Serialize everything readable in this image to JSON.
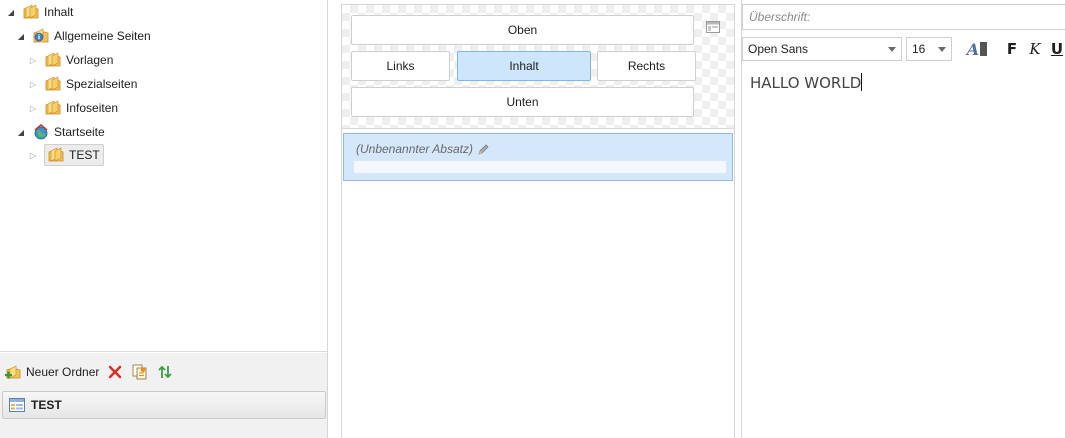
{
  "tree": {
    "items": [
      {
        "label": "Inhalt",
        "expanded": true,
        "icon": "folder-icon"
      },
      {
        "label": "Allgemeine Seiten",
        "expanded": true,
        "icon": "info-folder-icon"
      },
      {
        "label": "Vorlagen",
        "expanded": false,
        "icon": "folder-icon"
      },
      {
        "label": "Spezialseiten",
        "expanded": false,
        "icon": "folder-icon"
      },
      {
        "label": "Infoseiten",
        "expanded": false,
        "icon": "folder-icon"
      },
      {
        "label": "Startseite",
        "expanded": true,
        "icon": "home-globe-icon"
      },
      {
        "label": "TEST",
        "expanded": false,
        "icon": "folder-icon",
        "selected": true
      }
    ]
  },
  "toolbar": {
    "new_folder_label": "Neuer Ordner",
    "delete_icon": "delete-icon",
    "copy_icon": "copy-page-icon",
    "sort_icon": "sort-icon"
  },
  "page_tab": {
    "label": "TEST"
  },
  "layout": {
    "regions": {
      "top": "Oben",
      "left": "Links",
      "content": "Inhalt",
      "right": "Rechts",
      "bottom": "Unten"
    },
    "active_region": "Inhalt"
  },
  "paragraphs": [
    {
      "title": "(Unbenannter Absatz)"
    }
  ],
  "editor": {
    "heading_placeholder": "Überschrift:",
    "font_family": "Open Sans",
    "font_size": "16",
    "bold_label": "F",
    "italic_label": "K",
    "underline_label": "U",
    "color_label": "A",
    "content": "HALLO WORLD"
  },
  "colors": {
    "selection_fill": "#d5e7fb",
    "selection_border": "#8fbbe8",
    "active_region_fill": "#cde6fb",
    "folder_orange": "#f2b33d"
  }
}
